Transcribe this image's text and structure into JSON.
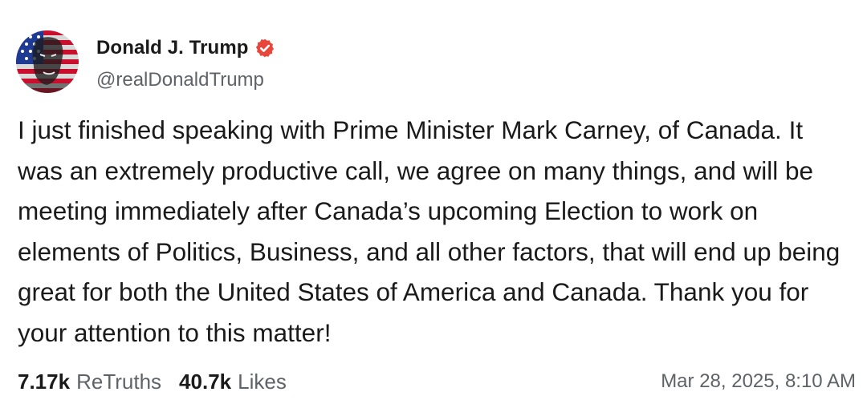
{
  "author": {
    "display_name": "Donald J. Trump",
    "handle": "@realDonaldTrump",
    "verified": true,
    "verified_icon": "verified-badge-icon",
    "avatar_icon": "profile-avatar"
  },
  "post": {
    "text": "I just finished speaking with Prime Minister Mark Carney, of Canada. It was an extremely productive call, we agree on many things, and will be meeting immediately after Canada’s upcoming Election to work on elements of Politics, Business, and all other factors, that will end up being great for both the United States of America and Canada. Thank you for your attention to this matter!"
  },
  "stats": {
    "retruths_count": "7.17k",
    "retruths_label": "ReTruths",
    "likes_count": "40.7k",
    "likes_label": "Likes"
  },
  "timestamp": "Mar 28, 2025, 8:10 AM",
  "colors": {
    "text": "#1a1a1a",
    "secondary_text": "#5f6368",
    "verified_badge": "#e8463b",
    "background": "#ffffff"
  }
}
